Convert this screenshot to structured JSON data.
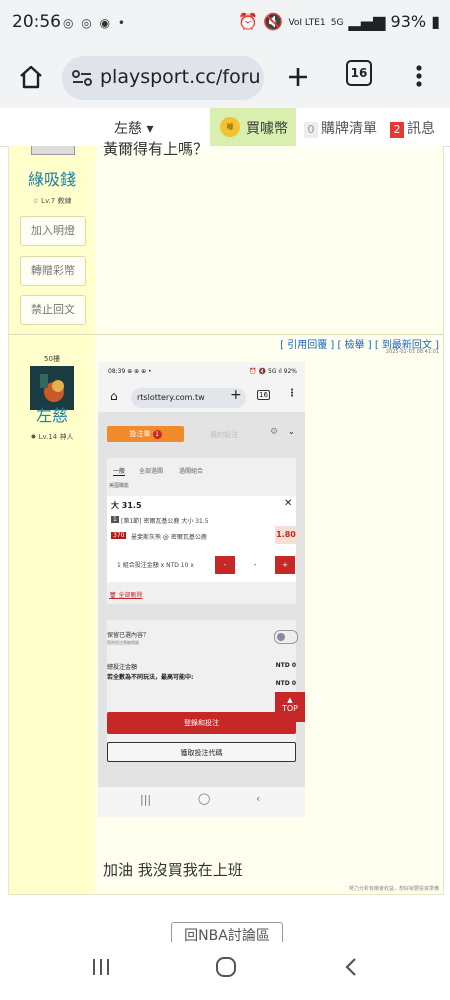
{
  "status_bar": {
    "time": "20:56",
    "notif_icons": "◎ ◎ ◉ •",
    "right_icons": "⏰ 🔇",
    "signal_volte": "VoI LTE1",
    "signal_5g": "5G",
    "battery": "93%"
  },
  "browser": {
    "url": "playsport.cc/foru",
    "tab_count": "16"
  },
  "forum_nav": {
    "user": "左慈 ▾",
    "buy_coin_icon_text": "噱",
    "buy_label": "買噱幣",
    "cart_count": "0",
    "cart_label": "購牌清單",
    "msg_count": "2",
    "msg_label": "訊息"
  },
  "post1": {
    "top_text": "黃爾得有上嗎？",
    "username": "綠吸錢",
    "level": "☆ Lv.7 教練",
    "buttons": [
      "加入明燈",
      "轉贈彩幣",
      "禁止回文"
    ]
  },
  "post2": {
    "avatar_label": "50樓",
    "username": "左慈",
    "level": "✸ Lv.14 神人",
    "links": "[ 引用回覆 ]  [ 檢舉 ]  [ 到最新回文 ]",
    "date": "2025-02-03 08:41:01",
    "text": "加油 我沒買我在上班",
    "footnote": "努力分析有機會收益，想好就要投資準備"
  },
  "screenshot": {
    "time": "08:39 ⊕ ⊕ ⊕ •",
    "status_right": "⏰ 🔇 5G ıl 92%",
    "url": "rtslottery.com.tw",
    "tab_count": "16",
    "betslip_tab": "投注單",
    "betslip_count": "1",
    "mybets_tab": "我的投注",
    "subtabs": [
      "一般",
      "全部過關",
      "過關組合"
    ],
    "league": "美國職籃",
    "pick": "大 31.5",
    "desc": "[第1節] 密爾瓦基公鹿 大小 31.5",
    "desc_tag": "1",
    "game_id": "370",
    "matchup": "曼斐斯灰熊 @ 密爾瓦基公鹿",
    "odds": "1.80",
    "stake_line": "1 組合投注金額 x NTD 10 x",
    "stake_value": "-",
    "delete_all": "全部刪除",
    "keep_label": "保留已選內容？",
    "keep_sub": "您的投注將被保留",
    "total_label": "總投注金額",
    "total_value": "NTD 0",
    "max_label": "若全數為不同玩法，最高可能中:",
    "max_value": "NTD 0",
    "login_btn": "登錄和投注",
    "code_btn": "獲取投注代碼",
    "top_btn": "TOP"
  },
  "back_button": "回NBA討論區"
}
